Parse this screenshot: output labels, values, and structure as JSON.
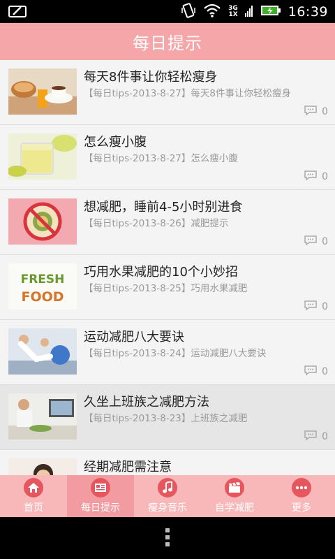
{
  "status_bar": {
    "time": "16:39",
    "network_top": "3G",
    "network_bottom": "1X"
  },
  "header": {
    "title": "每日提示"
  },
  "articles": [
    {
      "title": "每天8件事让你轻松瘦身",
      "summary": "【每日tips-2013-8-27】每天8件事让你轻松瘦身",
      "comments": "0",
      "thumb": "breakfast"
    },
    {
      "title": "怎么瘦小腹",
      "summary": "【每日tips-2013-8-27】怎么瘦小腹",
      "comments": "0",
      "thumb": "juice"
    },
    {
      "title": "想减肥，睡前4-5小时别进食",
      "summary": "【每日tips-2013-8-26】减肥提示",
      "comments": "0",
      "thumb": "no-food"
    },
    {
      "title": "巧用水果减肥的10个小妙招",
      "summary": "【每日tips-2013-8-25】巧用水果减肥",
      "comments": "0",
      "thumb": "fresh-food"
    },
    {
      "title": "运动减肥八大要诀",
      "summary": "【每日tips-2013-8-24】运动减肥八大要诀",
      "comments": "0",
      "thumb": "exercise"
    },
    {
      "title": "久坐上班族之减肥方法",
      "summary": "【每日tips-2013-8-23】上班族之减肥",
      "comments": "0",
      "thumb": "office"
    },
    {
      "title": "经期减肥需注意",
      "summary": "",
      "comments": "",
      "thumb": "woman"
    }
  ],
  "thumb_text": {
    "fresh": "FRESH",
    "food": "FOOD"
  },
  "tabs": [
    {
      "label": "首页",
      "icon": "home-icon"
    },
    {
      "label": "每日提示",
      "icon": "newspaper-icon"
    },
    {
      "label": "瘦身音乐",
      "icon": "music-icon"
    },
    {
      "label": "自学减肥",
      "icon": "clapper-icon"
    },
    {
      "label": "更多",
      "icon": "more-icon"
    }
  ],
  "active_tab": 1,
  "colors": {
    "header": "#f5a6a8",
    "tabbar": "#f8b7b9",
    "tab_active": "#f29ba0",
    "tab_icon": "#e5565e"
  }
}
